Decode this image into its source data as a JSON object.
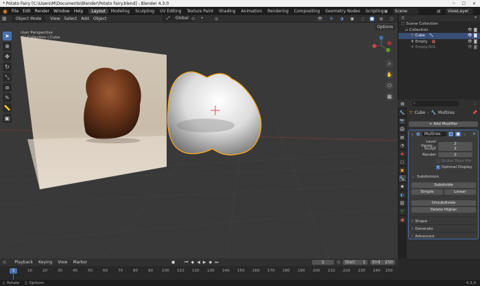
{
  "window": {
    "title": "* Potato Fairy [C:\\Users\\M\\Documents\\Blender\\Potato Fairy.blend] - Blender 4.3.0"
  },
  "menu": [
    "File",
    "Edit",
    "Render",
    "Window",
    "Help"
  ],
  "workspaces": [
    "Layout",
    "Modeling",
    "Sculpting",
    "UV Editing",
    "Texture Paint",
    "Shading",
    "Animation",
    "Rendering",
    "Compositing",
    "Geometry Nodes",
    "Scripting"
  ],
  "scene": {
    "name": "Scene",
    "view_layer": "ViewLayer"
  },
  "viewport": {
    "mode": "Object Mode",
    "menus": [
      "View",
      "Select",
      "Add",
      "Object"
    ],
    "orientation": "Global",
    "options_label": "Options",
    "overlay_text": [
      "User Perspective",
      "(1) Collection | Cube"
    ]
  },
  "outliner": {
    "root": "Scene Collection",
    "collection": "Collection",
    "items": [
      "Cube",
      "Empty",
      "Empty.001"
    ]
  },
  "properties": {
    "search_placeholder": "",
    "breadcrumb_object": "Cube",
    "breadcrumb_modifier": "Multires",
    "add_modifier": "Add Modifier",
    "modifier_name": "Multires",
    "level_viewport_label": "Level Viewp...",
    "level_viewport": "2",
    "sculpt_label": "Sculpt",
    "sculpt": "2",
    "render_label": "Render",
    "render": "2",
    "sculpt_base_mesh": "Sculpt Base Me...",
    "optimal_display": "Optimal Display",
    "subdivision_section": "Subdivision",
    "subdivide": "Subdivide",
    "simple": "Simple",
    "linear": "Linear",
    "unsubdivide": "Unsubdivide",
    "delete_higher": "Delete Higher",
    "shape": "Shape",
    "generate": "Generate",
    "advanced": "Advanced"
  },
  "timeline": {
    "menus": [
      "Playback",
      "Keying",
      "View",
      "Marker"
    ],
    "current_frame": "1",
    "start_label": "Start",
    "start": "1",
    "end_label": "End",
    "end": "250",
    "ticks": [
      "1",
      "10",
      "20",
      "30",
      "40",
      "50",
      "60",
      "70",
      "80",
      "90",
      "100",
      "110",
      "120",
      "130",
      "140",
      "150",
      "160",
      "170",
      "180",
      "190",
      "200",
      "210",
      "220",
      "230",
      "240",
      "250"
    ]
  },
  "status": {
    "left1": "Rotate",
    "left2": "Options",
    "version": "4.3.0"
  },
  "colors": {
    "accent": "#4772b3",
    "selection_outline": "#f5a623",
    "background": "#393939"
  }
}
